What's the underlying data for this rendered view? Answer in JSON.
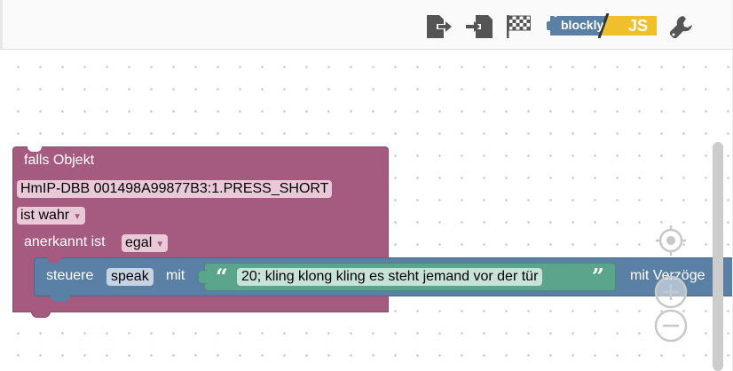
{
  "toolbar": {
    "blockly_label": "blockly",
    "js_label": "JS",
    "icons": [
      "export-icon",
      "import-icon",
      "checkered-flag-icon",
      "blockly-js-toggle",
      "wrench-icon"
    ]
  },
  "event_block": {
    "title": "falls Objekt",
    "object_id": "HmIP-DBB 001498A99877B3:1.PRESS_SHORT",
    "condition": "ist wahr",
    "ack_label": "anerkannt ist",
    "ack_value": "egal",
    "color": "#a55b80"
  },
  "action_block": {
    "label_control": "steuere",
    "target": "speak",
    "label_with": "mit",
    "string_value": "20; kling klong kling es steht jemand vor der tür",
    "quote_open": "“",
    "quote_close": "”",
    "label_delay": "mit Verzöge",
    "color": "#5b80a5",
    "string_color": "#5ba58c"
  },
  "zoom": {
    "icons": [
      "recenter-icon",
      "zoom-in-icon",
      "zoom-out-icon"
    ]
  }
}
